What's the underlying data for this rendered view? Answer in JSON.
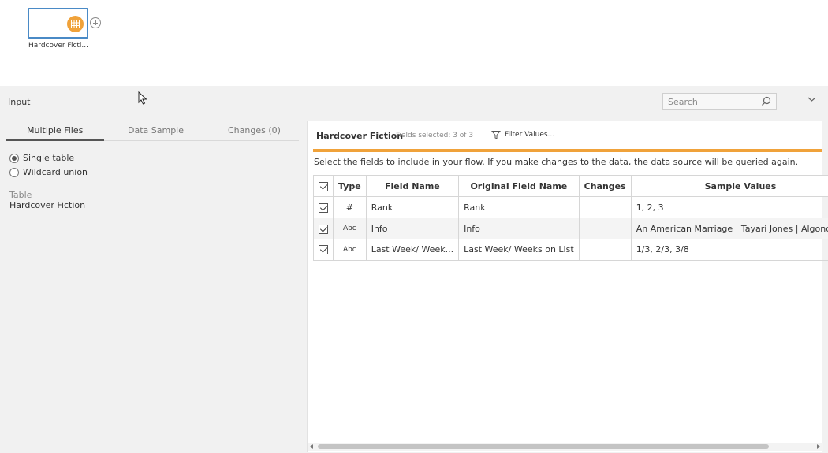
{
  "canvas": {
    "node_label": "Hardcover Ficti..."
  },
  "panel": {
    "title": "Input",
    "search_placeholder": "Search",
    "tabs": [
      {
        "label": "Multiple Files"
      },
      {
        "label": "Data Sample"
      },
      {
        "label": "Changes (0)"
      }
    ],
    "options": [
      {
        "label": "Single table",
        "selected": true
      },
      {
        "label": "Wildcard union",
        "selected": false
      }
    ],
    "table_label": "Table",
    "table_value": "Hardcover Fiction"
  },
  "fields_panel": {
    "title": "Hardcover Fiction",
    "count_text": "Fields selected: 3 of 3",
    "filter_label": "Filter Values...",
    "instruction": "Select the fields to include in your flow. If you make changes to the data, the data source will be queried again.",
    "columns": {
      "type": "Type",
      "field_name": "Field Name",
      "original_field_name": "Original Field Name",
      "changes": "Changes",
      "sample_values": "Sample Values"
    },
    "rows": [
      {
        "type_label": "#",
        "field": "Rank",
        "original": "Rank",
        "changes": "",
        "sample": "1, 2, 3",
        "checked": true
      },
      {
        "type_label": "Abc",
        "field": "Info",
        "original": "Info",
        "changes": "",
        "sample": "An American Marriage | Tayari Jones | Algonquin",
        "checked": true
      },
      {
        "type_label": "Abc",
        "field": "Last Week/ Week...",
        "original": "Last Week/ Weeks on List",
        "changes": "",
        "sample": "1/3, 2/3, 3/8",
        "checked": true
      }
    ]
  },
  "colors": {
    "accent_orange": "#f0a23a",
    "node_border": "#4a8ac6",
    "panel_bg": "#f1f1f1"
  }
}
